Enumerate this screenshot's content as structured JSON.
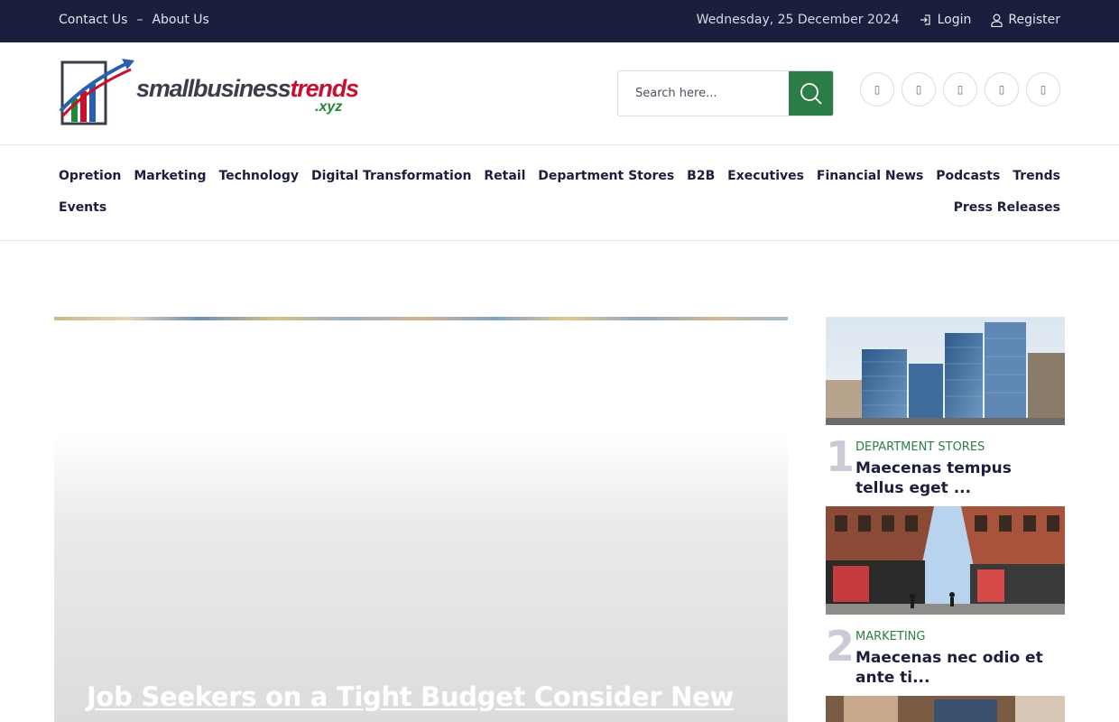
{
  "topbar": {
    "contact": "Contact Us",
    "separator": "–",
    "about": "About Us",
    "date": "Wednesday, 25 December 2024",
    "login": "Login",
    "register": "Register"
  },
  "header": {
    "logo_main_a": "smallbusiness",
    "logo_main_b": "trends",
    "logo_tld": ".xyz",
    "search_placeholder": "Search here...",
    "social_icons": [
      "facebook-icon",
      "twitter-icon",
      "instagram-icon",
      "linkedin-icon",
      "youtube-icon"
    ]
  },
  "nav": {
    "row1": [
      "Opretion",
      "Marketing",
      "Technology",
      "Digital Transformation",
      "Retail",
      "Department Stores",
      "B2B",
      "Executives",
      "Financial News",
      "Podcasts",
      "Trends"
    ],
    "row2_left": "Events",
    "row2_right": "Press Releases"
  },
  "featured": {
    "title": "Job Seekers on a Tight Budget Consider New"
  },
  "sidebar": {
    "items": [
      {
        "number": "1",
        "category": "DEPARTMENT STORES",
        "title": "Maecenas tempus tellus eget ..."
      },
      {
        "number": "2",
        "category": "MARKETING",
        "title": "Maecenas nec odio et ante ti..."
      }
    ]
  },
  "colors": {
    "topbar_bg": "#1b1e3c",
    "accent_green": "#2d7d46",
    "text_dark": "#1b1e3c"
  }
}
